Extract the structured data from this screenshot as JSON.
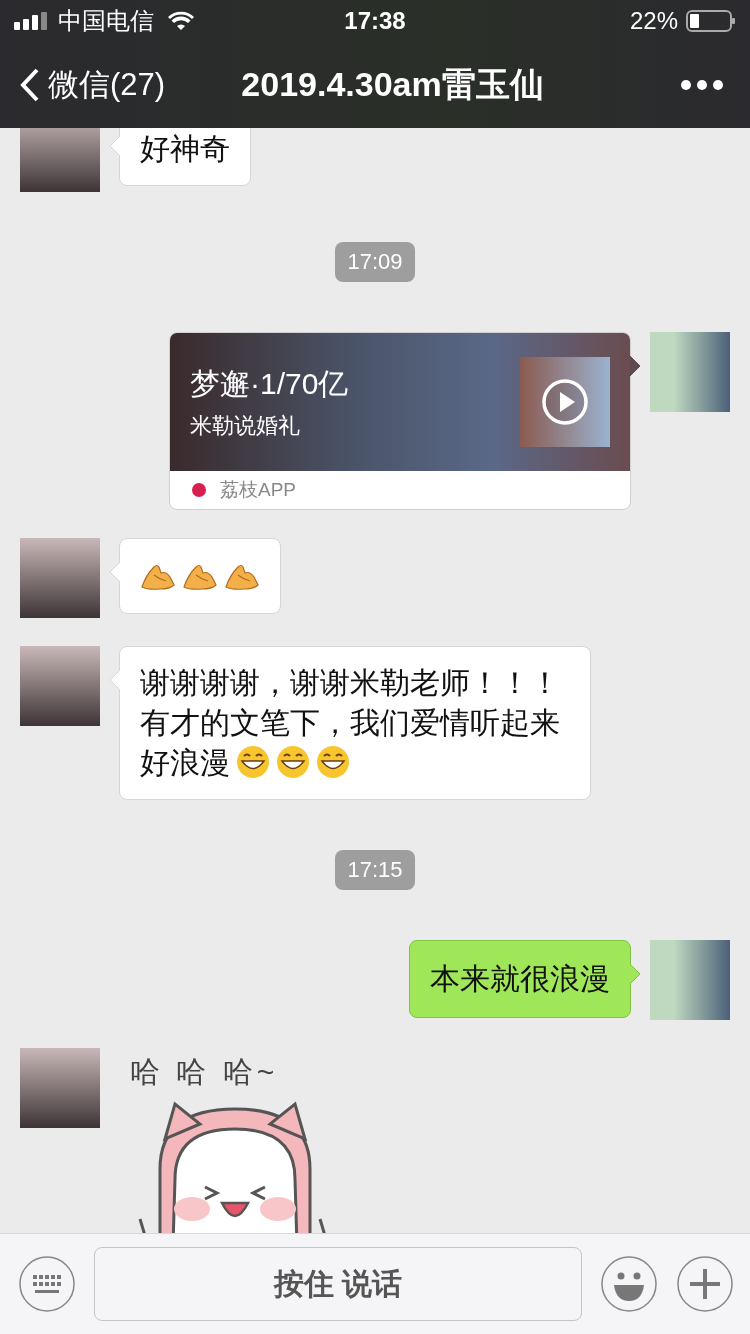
{
  "status_bar": {
    "carrier": "中国电信",
    "time": "17:38",
    "battery": "22%"
  },
  "nav": {
    "back": "微信(27)",
    "title": "2019.4.30am雷玉仙"
  },
  "messages": [
    {
      "kind": "text",
      "outgoing": false,
      "text": "好神奇"
    },
    {
      "kind": "time",
      "text": "17:09"
    },
    {
      "kind": "link_card",
      "outgoing": true,
      "title": "梦邂·1/70亿",
      "subtitle": "米勒说婚礼",
      "source": "荔枝APP"
    },
    {
      "kind": "icons",
      "outgoing": false,
      "icons": [
        {
          "kind": "ok-hand"
        },
        {
          "kind": "ok-hand"
        },
        {
          "kind": "ok-hand"
        }
      ]
    },
    {
      "kind": "text",
      "outgoing": false,
      "text": "谢谢谢谢，谢谢米勒老师！！！有才的文笔下，我们爱情听起来",
      "tail": "好浪漫",
      "icons": [
        {
          "kind": "grin"
        },
        {
          "kind": "grin"
        },
        {
          "kind": "grin"
        }
      ]
    },
    {
      "kind": "time",
      "text": "17:15"
    },
    {
      "kind": "text",
      "outgoing": true,
      "text": "本来就很浪漫"
    },
    {
      "kind": "sticker",
      "outgoing": false,
      "caption": "哈 哈 哈~"
    }
  ],
  "input_bar": {
    "talk": "按住 说话"
  }
}
